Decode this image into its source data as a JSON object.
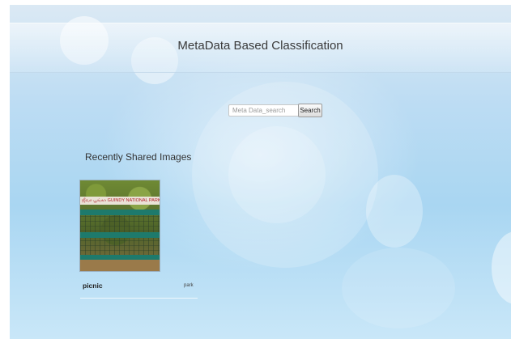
{
  "header": {
    "title": "MetaData Based Classification"
  },
  "search": {
    "placeholder": "Meta Data_search",
    "value": "",
    "button_label": "Search"
  },
  "recent": {
    "heading": "Recently Shared Images",
    "items": [
      {
        "name": "picnic",
        "tag": "park",
        "image_sign_text": "ஜீவா பூங்கா   GUINDY NATIONAL PARK"
      }
    ]
  }
}
